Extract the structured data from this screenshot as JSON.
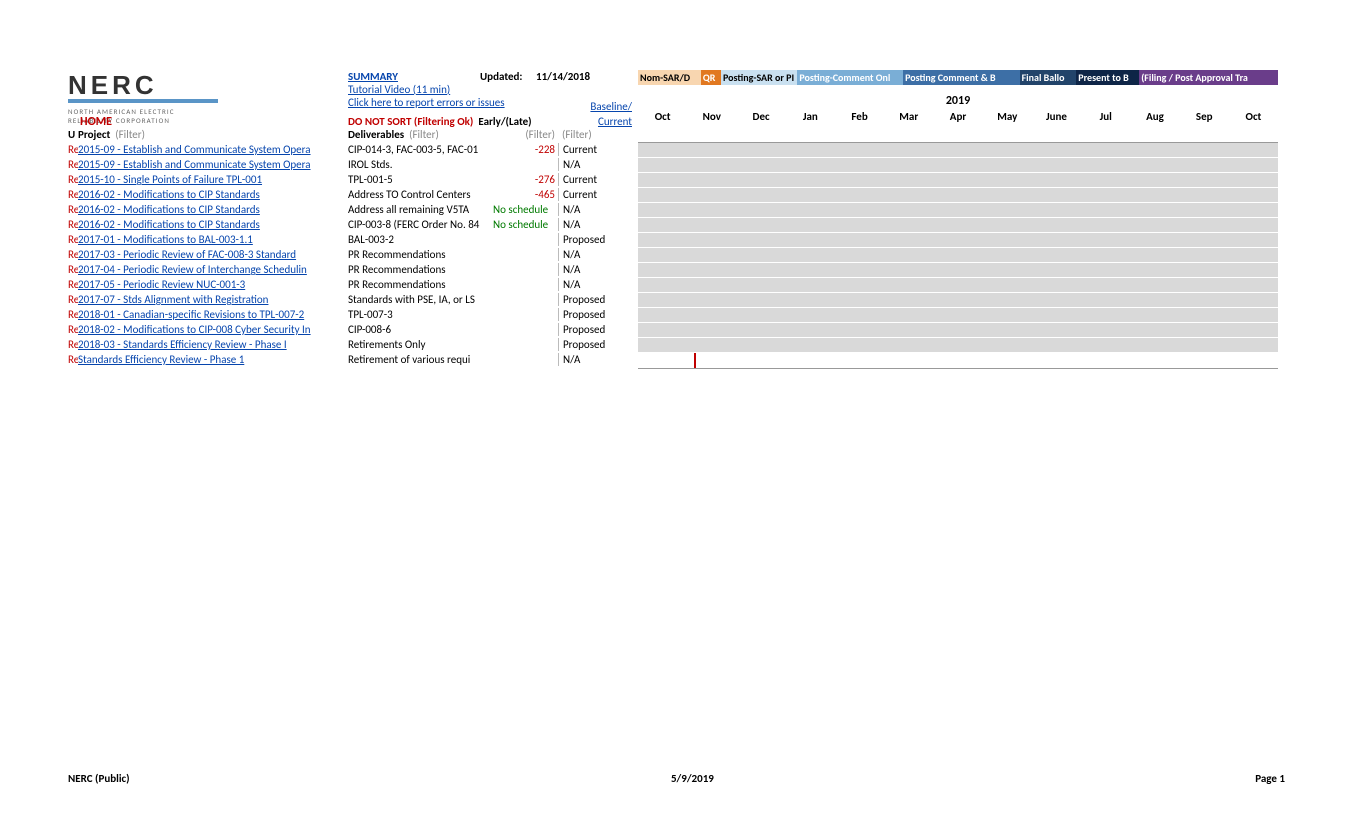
{
  "logo": {
    "name": "NERC",
    "sub1": "NORTH AMERICAN ELECTRIC",
    "sub2": "RELIABILITY CORPORATION"
  },
  "links": {
    "summary": "SUMMARY",
    "tutorial": "Tutorial Video (11 min)",
    "report": "Click here to report errors or issues",
    "baseline": "Baseline/",
    "current": "Current"
  },
  "updated": {
    "label": "Updated:",
    "value": "11/14/2018"
  },
  "home": "HOME",
  "donotsort": "DO NOT SORT (Filtering Ok)",
  "early_late": "Early/(Late)",
  "headers": {
    "u": "U",
    "project": "Project",
    "deliverables": "Deliverables",
    "filter": "(Filter)"
  },
  "legend": {
    "l1": "Nom-SAR/D",
    "l2": "QR",
    "l3": "Posting-SAR or PI",
    "l4": "Posting-Comment Onl",
    "l5": "Posting Comment & B",
    "l6": "Final Ballo",
    "l7": "Present to B",
    "l8": "(Filing / Post Approval Tra"
  },
  "year": "2019",
  "months": [
    "Oct",
    "Nov",
    "Dec",
    "Jan",
    "Feb",
    "Mar",
    "Apr",
    "May",
    "June",
    "Jul",
    "Aug",
    "Sep",
    "Oct"
  ],
  "rows": [
    {
      "u": "Re",
      "proj": "2015-09 - Establish and Communicate System Opera",
      "deliv": "CIP-014-3, FAC-003-5, FAC-01",
      "early": "-228",
      "early_color": "red",
      "status": "Current"
    },
    {
      "u": "Re",
      "proj": "2015-09 - Establish and Communicate System Opera",
      "deliv": "IROL Stds.",
      "early": "",
      "status": "N/A"
    },
    {
      "u": "Re",
      "proj": "2015-10 - Single Points of Failure TPL-001",
      "deliv": "TPL-001-5",
      "early": "-276",
      "early_color": "red",
      "status": "Current"
    },
    {
      "u": "Re",
      "proj": "2016-02 - Modifications to CIP Standards",
      "deliv": "Address TO Control Centers",
      "early": "-465",
      "early_color": "red",
      "status": "Current"
    },
    {
      "u": "Re",
      "proj": "2016-02 - Modifications to CIP Standards",
      "deliv": "Address all remaining V5TA",
      "early": "No schedule",
      "early_color": "green",
      "status": "N/A"
    },
    {
      "u": "Re",
      "proj": "2016-02 - Modifications to CIP Standards",
      "deliv": "CIP-003-8 (FERC Order No. 84",
      "early": "No schedule",
      "early_color": "green",
      "status": "N/A"
    },
    {
      "u": "Re",
      "proj": "2017-01 - Modifications to BAL-003-1.1",
      "deliv": "BAL-003-2",
      "early": "",
      "status": "Proposed"
    },
    {
      "u": "Re",
      "proj": "2017-03 - Periodic Review of FAC-008-3 Standard",
      "deliv": "PR Recommendations",
      "early": "",
      "status": "N/A"
    },
    {
      "u": "Re",
      "proj": "2017-04 - Periodic Review of Interchange Schedulin",
      "deliv": "PR Recommendations",
      "early": "",
      "status": "N/A"
    },
    {
      "u": "Re",
      "proj": "2017-05 - Periodic Review NUC-001-3",
      "deliv": "PR Recommendations",
      "early": "",
      "status": "N/A"
    },
    {
      "u": "Re",
      "proj": "2017-07 - Stds Alignment with Registration",
      "deliv": "Standards with PSE, IA, or LS",
      "early": "",
      "status": "Proposed"
    },
    {
      "u": "Re",
      "proj": "2018-01 - Canadian-specific Revisions to TPL-007-2",
      "deliv": "TPL-007-3",
      "early": "",
      "status": "Proposed"
    },
    {
      "u": "Re",
      "proj": "2018-02 - Modifications to CIP-008 Cyber Security In",
      "deliv": "CIP-008-6",
      "early": "",
      "status": "Proposed"
    },
    {
      "u": "Re",
      "proj": "2018-03 - Standards Efficiency Review - Phase I",
      "deliv": "Retirements Only",
      "early": "",
      "status": "Proposed"
    },
    {
      "u": "Re",
      "proj": "Standards Efficiency Review - Phase 1",
      "deliv": "Retirement of various requi",
      "early": "",
      "status": "N/A",
      "last": true
    }
  ],
  "footer": {
    "left": "NERC (Public)",
    "center": "5/9/2019",
    "right": "Page 1"
  }
}
